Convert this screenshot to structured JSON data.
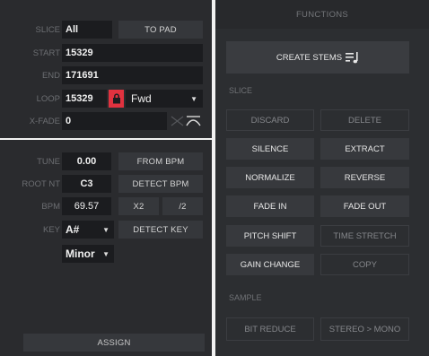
{
  "slice": {
    "label": "SLICE",
    "value": "All",
    "to_pad": "TO PAD"
  },
  "start": {
    "label": "START",
    "value": "15329"
  },
  "end": {
    "label": "END",
    "value": "171691"
  },
  "loop": {
    "label": "LOOP",
    "value": "15329",
    "mode": "Fwd"
  },
  "xfade": {
    "label": "X-FADE",
    "value": "0"
  },
  "tune": {
    "label": "TUNE",
    "value": "0.00",
    "from_bpm": "FROM BPM"
  },
  "root": {
    "label": "ROOT NT",
    "value": "C3",
    "detect_bpm": "DETECT BPM"
  },
  "bpm": {
    "label": "BPM",
    "value": "69.57",
    "x2": "X2",
    "div2": "/2"
  },
  "key": {
    "label": "KEY",
    "value": "A#",
    "scale": "Minor",
    "detect_key": "DETECT KEY"
  },
  "assign": "ASSIGN",
  "functions": {
    "title": "FUNCTIONS",
    "create_stems": "CREATE STEMS",
    "slice_section": "SLICE",
    "sample_section": "SAMPLE",
    "discard": "DISCARD",
    "delete": "DELETE",
    "silence": "SILENCE",
    "extract": "EXTRACT",
    "normalize": "NORMALIZE",
    "reverse": "REVERSE",
    "fade_in": "FADE IN",
    "fade_out": "FADE OUT",
    "pitch_shift": "PITCH SHIFT",
    "time_stretch": "TIME STRETCH",
    "gain_change": "GAIN CHANGE",
    "copy": "COPY",
    "bit_reduce": "BIT REDUCE",
    "stereo_mono": "STEREO > MONO"
  },
  "colors": {
    "lock": "#e0323f",
    "panel": "#2a2b2e"
  }
}
